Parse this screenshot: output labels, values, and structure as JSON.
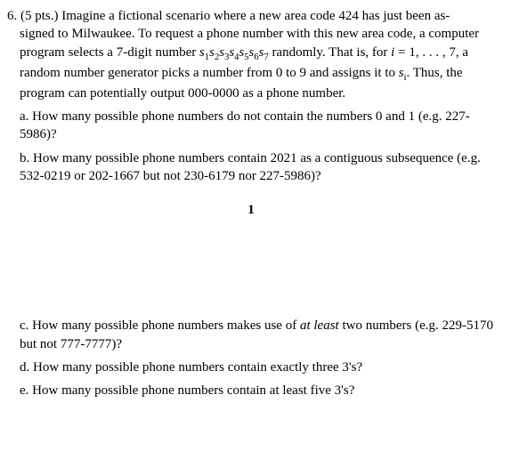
{
  "problem": {
    "number": "6.",
    "points": "(5 pts.)",
    "intro_line1": "Imagine a fictional scenario where a new area code 424 has just been as-",
    "intro_line2": "signed to Milwaukee. To request a phone number with this new area code, a computer program selects a 7-digit number ",
    "digits_expr": "s",
    "digits_sub": "1",
    "digits_expr2": "s",
    "digits_sub2": "2",
    "digits_expr3": "s",
    "digits_sub3": "3",
    "digits_expr4": "s",
    "digits_sub4": "4",
    "digits_expr5": "s",
    "digits_sub5": "5",
    "digits_expr6": "s",
    "digits_sub6": "6",
    "digits_expr7": "s",
    "digits_sub7": "7",
    "intro_line3": " randomly. That is, for ",
    "i_var": "i",
    "equals": " = ",
    "range": "1, . . . , 7",
    "intro_line4": ", a random number generator picks a number from 0 to 9 and assigns it to ",
    "si_s": "s",
    "si_i": "i",
    "intro_line5": ". Thus, the program can potentially output 000-0000 as a phone number.",
    "part_a": "a. How many possible phone numbers do not contain the numbers 0 and 1 (e.g. 227-5986)?",
    "part_b": "b. How many possible phone numbers contain 2021 as a contiguous subsequence (e.g. 532-0219 or 202-1667 but not 230-6179 nor 227-5986)?",
    "page_num": "1",
    "part_c_prefix": "c. How many possible phone numbers makes use of ",
    "part_c_italic": "at least",
    "part_c_suffix": " two numbers (e.g. 229-5170 but not 777-7777)?",
    "part_d": "d. How many possible phone numbers contain exactly three 3's?",
    "part_e": "e. How many possible phone numbers contain at least five 3's?"
  }
}
